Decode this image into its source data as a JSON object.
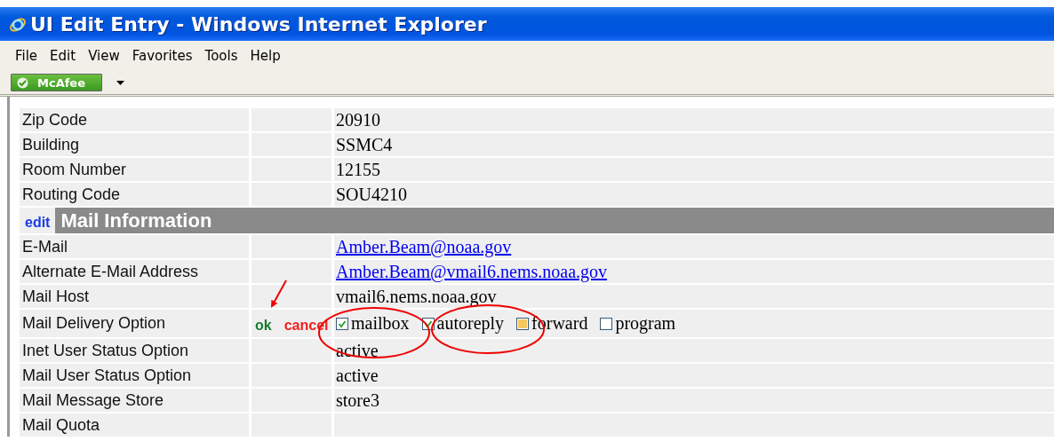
{
  "window": {
    "title": "UI Edit Entry - Windows Internet Explorer"
  },
  "menu": [
    "File",
    "Edit",
    "View",
    "Favorites",
    "Tools",
    "Help"
  ],
  "toolbar": {
    "addon": "McAfee"
  },
  "rows": [
    {
      "kind": "field",
      "label": "Zip Code",
      "value": "20910"
    },
    {
      "kind": "field",
      "label": "Building",
      "value": "SSMC4"
    },
    {
      "kind": "field",
      "label": "Room Number",
      "value": "12155"
    },
    {
      "kind": "field",
      "label": "Routing Code",
      "value": "SOU4210"
    },
    {
      "kind": "section",
      "action": "edit",
      "title": "Mail Information"
    },
    {
      "kind": "link",
      "label": "E-Mail",
      "value": "Amber.Beam@noaa.gov"
    },
    {
      "kind": "link",
      "label": "Alternate E-Mail Address",
      "value": "Amber.Beam@vmail6.nems.noaa.gov"
    },
    {
      "kind": "field",
      "label": "Mail Host",
      "value": "vmail6.nems.noaa.gov"
    },
    {
      "kind": "options",
      "label": "Mail Delivery Option",
      "ok": "ok",
      "cancel": "cancel",
      "options": [
        {
          "label": "mailbox",
          "checked": true,
          "focused": false
        },
        {
          "label": "autoreply",
          "checked": true,
          "focused": false
        },
        {
          "label": "forward",
          "checked": false,
          "focused": true
        },
        {
          "label": "program",
          "checked": false,
          "focused": false
        }
      ]
    },
    {
      "kind": "field",
      "label": "Inet User Status Option",
      "value": "active"
    },
    {
      "kind": "field",
      "label": "Mail User Status Option",
      "value": "active"
    },
    {
      "kind": "field",
      "label": "Mail Message Store",
      "value": "store3"
    },
    {
      "kind": "field",
      "label": "Mail Quota"
    }
  ]
}
